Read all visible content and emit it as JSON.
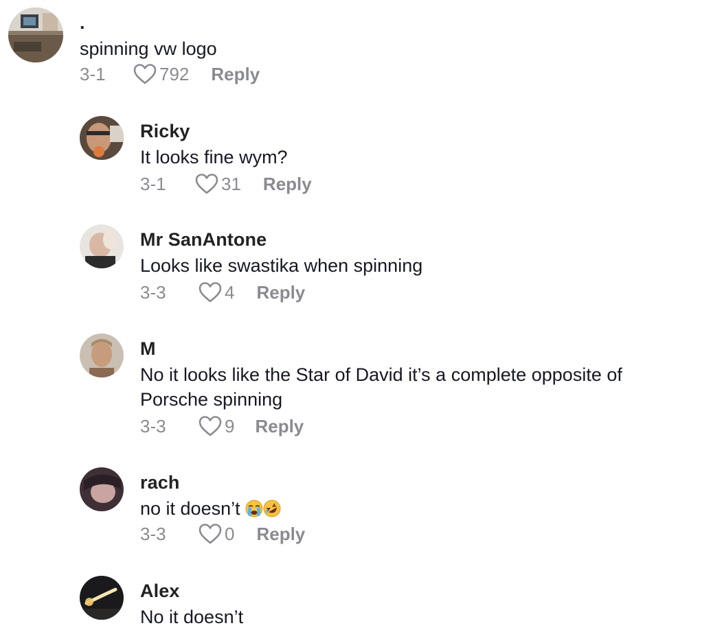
{
  "comments": [
    {
      "username": ".",
      "text": [
        "spinning vw logo"
      ],
      "date": "3-1",
      "likes": "792",
      "reply_label": "Reply",
      "level": "top"
    },
    {
      "username": "Ricky",
      "text": [
        "It looks fine wym?"
      ],
      "date": "3-1",
      "likes": "31",
      "reply_label": "Reply",
      "level": "reply"
    },
    {
      "username": "Mr SanAntone",
      "text": [
        "Looks like swastika when spinning"
      ],
      "date": "3-3",
      "likes": "4",
      "reply_label": "Reply",
      "level": "reply"
    },
    {
      "username": "M",
      "text": [
        "No it looks like the Star of David it’s a complete opposite of",
        "Porsche spinning"
      ],
      "date": "3-3",
      "likes": "9",
      "reply_label": "Reply",
      "level": "reply"
    },
    {
      "username": "rach",
      "text": [
        "no it doesn’t"
      ],
      "emojis": [
        "loudly-crying-face",
        "rolling-on-floor-laughing"
      ],
      "date": "3-3",
      "likes": "0",
      "reply_label": "Reply",
      "level": "reply"
    },
    {
      "username": "Alex",
      "text": [
        "No it doesn’t"
      ],
      "level": "reply"
    }
  ],
  "icons": {
    "like": "heart-outline-icon"
  },
  "colors": {
    "text": "#161823",
    "username": "#222222",
    "meta": "#8a8b91"
  }
}
